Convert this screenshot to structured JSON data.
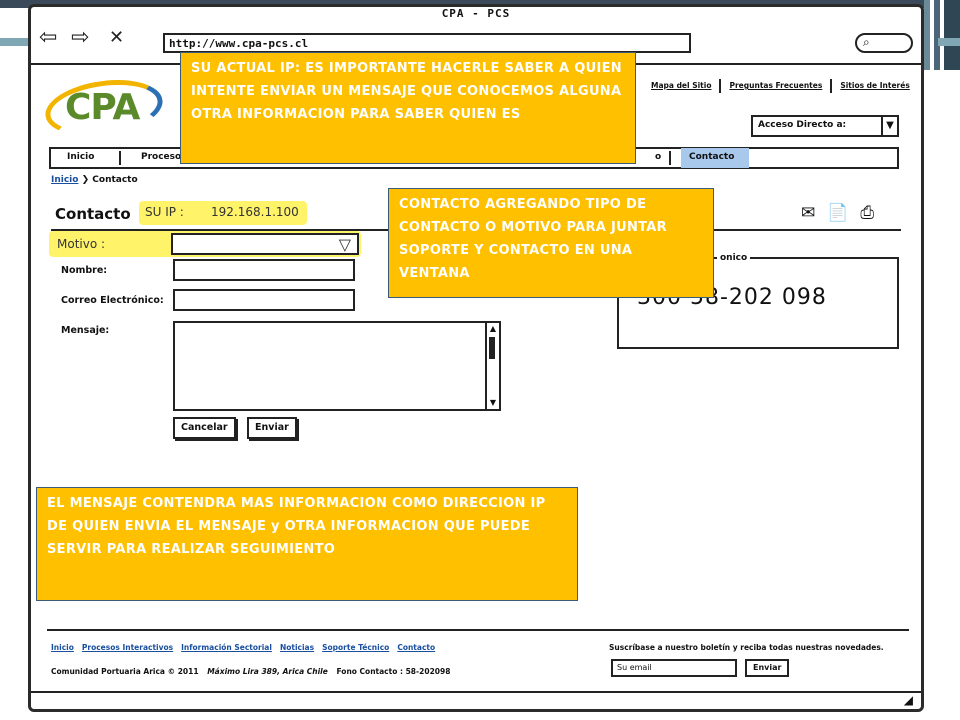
{
  "browser": {
    "title": "CPA - PCS",
    "url": "http://www.cpa-pcs.cl",
    "back_glyph": "⇦",
    "forward_glyph": "⇨",
    "close_glyph": "✕",
    "search_glyph": "⌕"
  },
  "site": {
    "logo_text": "CPA",
    "top_links": [
      "Mapa del Sitio",
      "Preguntas Frecuentes",
      "Sitios de Interés"
    ],
    "quick_access": "Acceso Directo a:",
    "menu": [
      "Inicio",
      "Proceso",
      "o"
    ],
    "menu_active": "Contacto",
    "breadcrumb_home": "Inicio",
    "breadcrumb_arrow": "❯",
    "breadcrumb_current": "Contacto",
    "page_title": "Contacto"
  },
  "form": {
    "ip_label": "SU IP :",
    "ip_value": "192.168.1.100",
    "motive_label": "Motivo :",
    "motive_arrow": "▽",
    "name_label": "Nombre:",
    "email_label": "Correo Electrónico:",
    "message_label": "Mensaje:",
    "cancel_label": "Cancelar",
    "send_label": "Enviar"
  },
  "phone": {
    "legend": "onico",
    "number": "300 58-202 098"
  },
  "annotations": {
    "ip_note": "SU ACTUAL IP: ES IMPORTANTE HACERLE SABER A QUIEN INTENTE ENVIAR UN MENSAJE QUE CONOCEMOS ALGUNA OTRA INFORMACION PARA SABER QUIEN ES",
    "contact_note": "CONTACTO AGREGANDO TIPO DE CONTACTO O MOTIVO PARA JUNTAR SOPORTE Y CONTACTO EN UNA VENTANA",
    "message_note": "EL MENSAJE CONTENDRA MAS INFORMACION COMO DIRECCION IP DE QUIEN ENVIA EL MENSAJE y OTRA INFORMACION QUE PUEDE SERVIR PARA REALIZAR SEGUIMIENTO"
  },
  "footer": {
    "links": [
      "Inicio",
      "Procesos Interactivos",
      "Información Sectorial",
      "Noticias",
      "Soporte Técnico",
      "Contacto"
    ],
    "community": "Comunidad Portuaria Arica © 2011",
    "address": "Máximo Lira 389, Arica Chile",
    "phone": "Fono Contacto : 58-202098",
    "newsletter": "Suscríbase a nuestro boletín y reciba todas nuestras novedades.",
    "email_placeholder": "Su email",
    "send_label": "Enviar"
  },
  "colors": {
    "annotation": "#ffc000",
    "highlight": "#fff36a",
    "menu_active": "#a8c8ec"
  }
}
